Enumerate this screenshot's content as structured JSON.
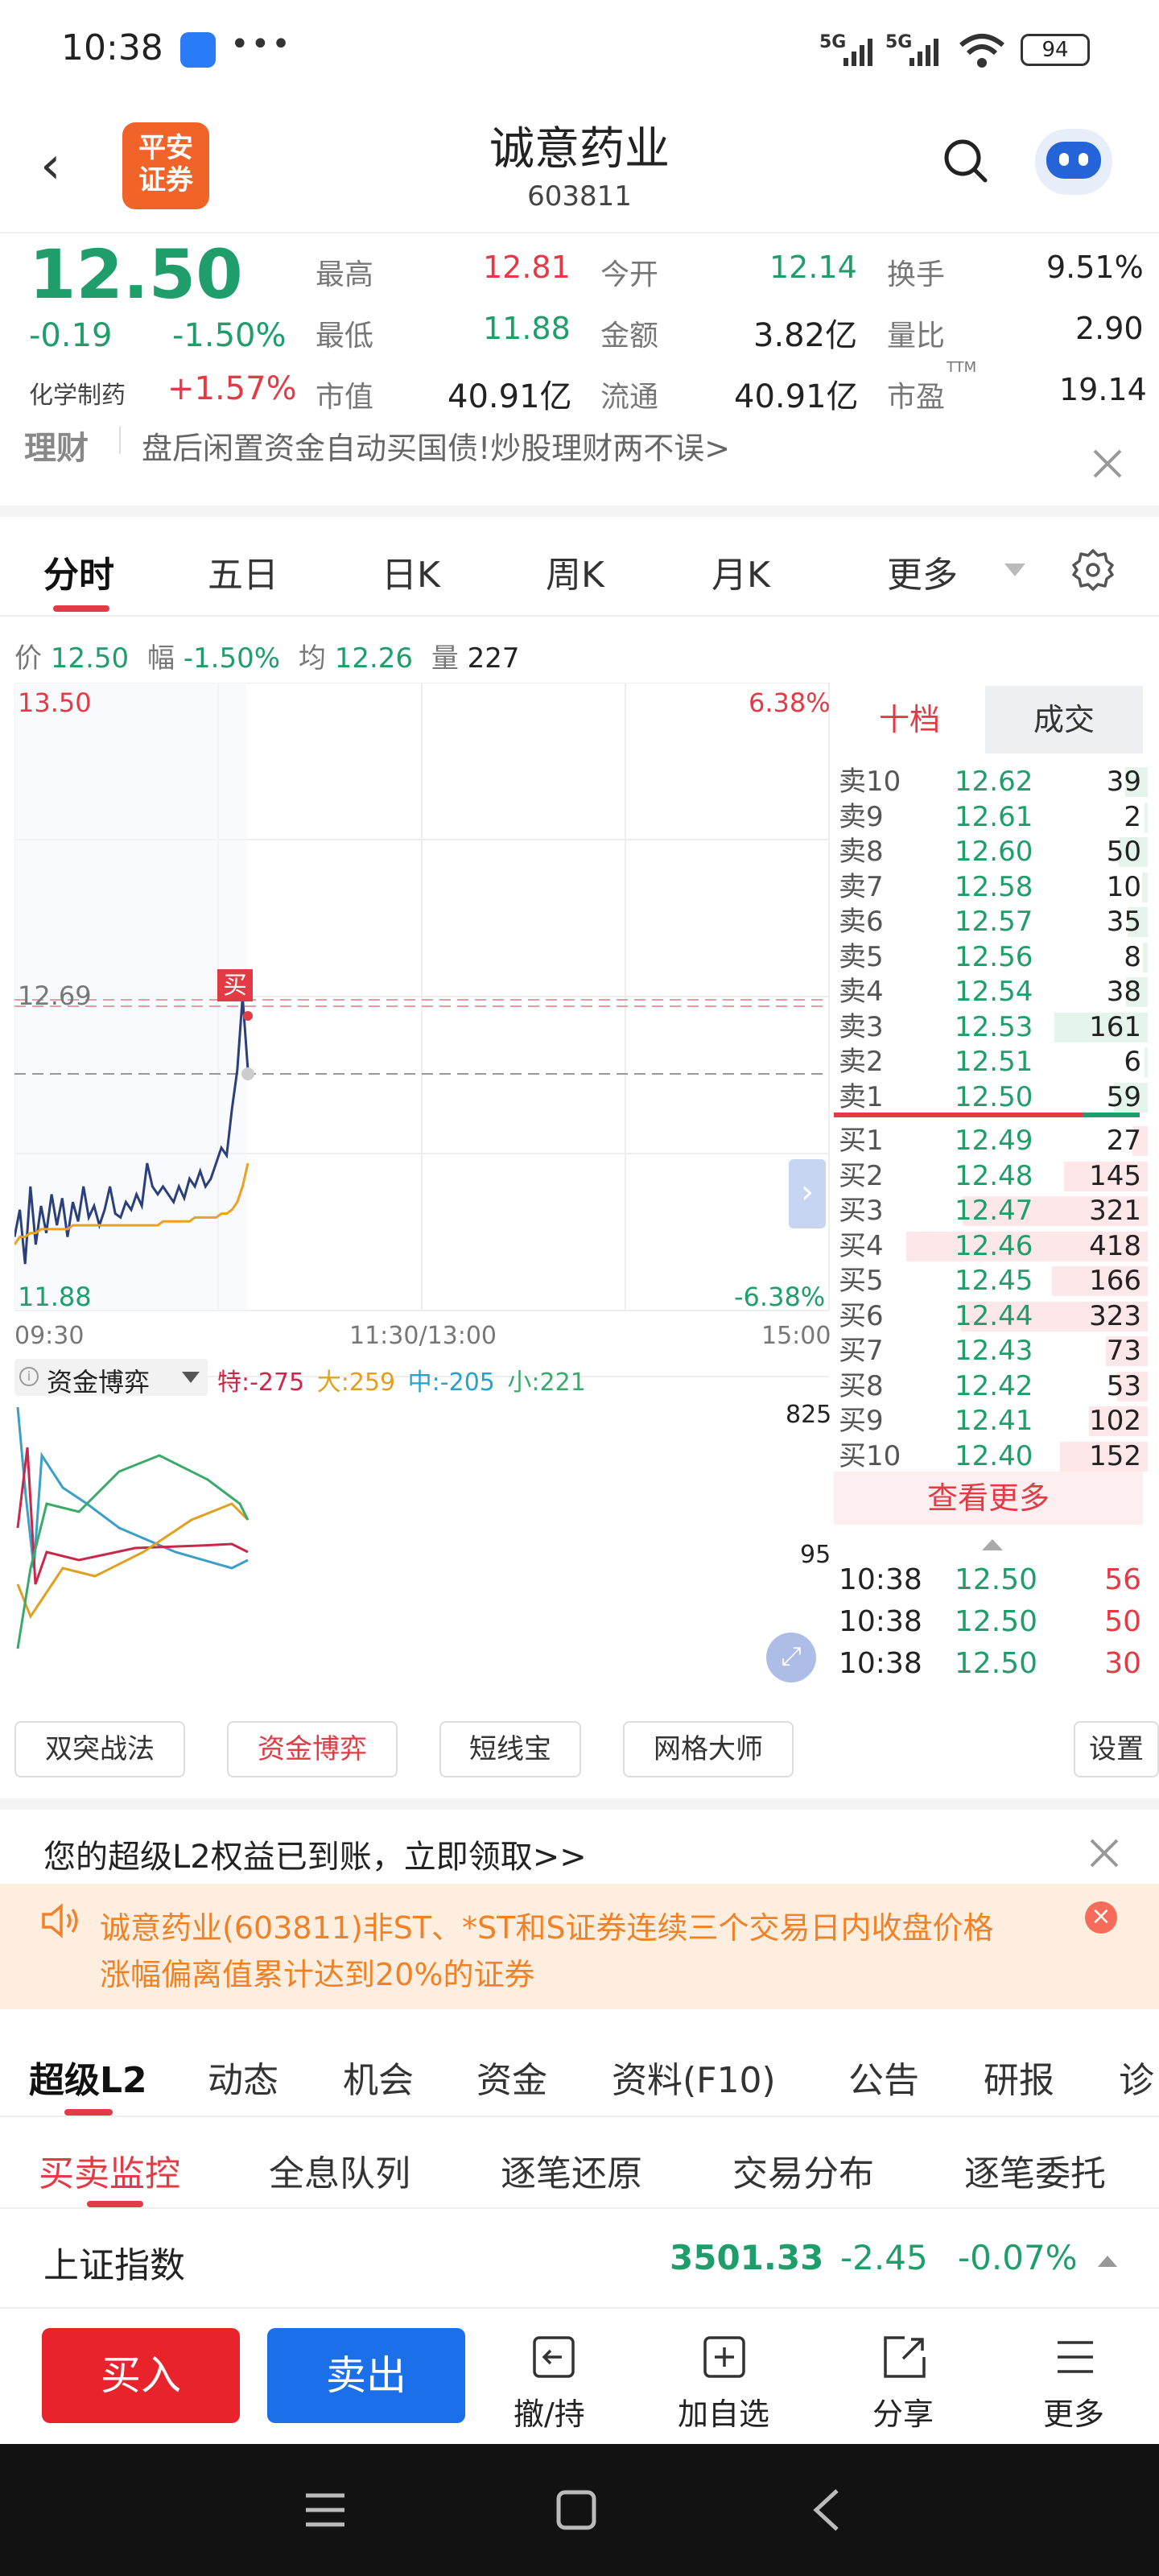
{
  "status_bar": {
    "time": "10:38",
    "dots": "•••",
    "signal1": "5G",
    "signal2": "5G",
    "battery": "94"
  },
  "header": {
    "back_icon": "chevron-left-icon",
    "logo_line1": "平安",
    "logo_line2": "证券",
    "title": "诚意药业",
    "code": "603811"
  },
  "quote": {
    "price": "12.50",
    "change": "-0.19",
    "change_pct": "-1.50%",
    "sector": "化学制药",
    "sector_pct": "+1.57%",
    "high_label": "最高",
    "high": "12.81",
    "low_label": "最低",
    "low": "11.88",
    "mktcap_label": "市值",
    "mktcap": "40.91亿",
    "open_label": "今开",
    "open": "12.14",
    "amount_label": "金额",
    "amount": "3.82亿",
    "float_label": "流通",
    "float": "40.91亿",
    "turnover_label": "换手",
    "turnover": "9.51%",
    "volratio_label": "量比",
    "volratio": "2.90",
    "pe_label": "市盈",
    "pe_sup": "TTM",
    "pe": "19.14"
  },
  "banner": {
    "tag": "理财",
    "text": "盘后闲置资金自动买国债!炒股理财两不误>"
  },
  "chart_tabs": {
    "items": [
      "分时",
      "五日",
      "日K",
      "周K",
      "月K",
      "更多"
    ]
  },
  "info_line": {
    "price_label": "价",
    "price": "12.50",
    "range_label": "幅",
    "range": "-1.50%",
    "avg_label": "均",
    "avg": "12.26",
    "vol_label": "量",
    "vol": "227"
  },
  "chart_labels": {
    "y_top": "13.50",
    "y_mark": "12.69",
    "y_bottom": "11.88",
    "pct_top": "6.38%",
    "pct_bottom": "-6.38%",
    "x_start": "09:30",
    "x_mid": "11:30/13:00",
    "x_end": "15:00",
    "buy_marker": "买",
    "fund_title": "资金博弈",
    "fund_te_label": "特:",
    "fund_te": "-275",
    "fund_da_label": "大:",
    "fund_da": "259",
    "fund_zhong_label": "中:",
    "fund_zhong": "-205",
    "fund_xiao_label": "小:",
    "fund_xiao": "221",
    "fund_y_top": "825",
    "fund_y_mid": "95"
  },
  "chart_data": [
    {
      "type": "line",
      "title": "",
      "ylim": [
        11.88,
        13.5
      ],
      "xlabel": "",
      "ylabel": "",
      "grid": true,
      "x_ticks": [
        "09:30",
        "11:30/13:00",
        "15:00"
      ],
      "series": [
        {
          "values": [
            12.07,
            12.14,
            12.0,
            12.2,
            12.05,
            12.15,
            12.08,
            12.18,
            12.1,
            12.17,
            12.07,
            12.16,
            12.11,
            12.2,
            12.12,
            12.15,
            12.1,
            12.14,
            12.2,
            12.13,
            12.12,
            12.16,
            12.14,
            12.18,
            12.15,
            12.26,
            12.2,
            12.18,
            12.2,
            12.18,
            12.16,
            12.2,
            12.17,
            12.22,
            12.2,
            12.24,
            12.2,
            12.22,
            12.26,
            12.3,
            12.28,
            12.4,
            12.5,
            12.69,
            12.5
          ]
        },
        {
          "values": [
            12.05,
            12.07,
            12.07,
            12.08,
            12.08,
            12.09,
            12.09,
            12.09,
            12.09,
            12.09,
            12.09,
            12.1,
            12.1,
            12.1,
            12.1,
            12.1,
            12.1,
            12.1,
            12.1,
            12.1,
            12.1,
            12.1,
            12.1,
            12.1,
            12.1,
            12.1,
            12.1,
            12.1,
            12.11,
            12.11,
            12.11,
            12.11,
            12.11,
            12.11,
            12.12,
            12.12,
            12.12,
            12.12,
            12.12,
            12.13,
            12.13,
            12.14,
            12.16,
            12.2,
            12.26
          ]
        }
      ]
    }
  ],
  "order_book": {
    "tab_active": "十档",
    "tab_other": "成交",
    "asks": [
      {
        "label": "卖10",
        "price": "12.62",
        "vol": "39"
      },
      {
        "label": "卖9",
        "price": "12.61",
        "vol": "2"
      },
      {
        "label": "卖8",
        "price": "12.60",
        "vol": "50"
      },
      {
        "label": "卖7",
        "price": "12.58",
        "vol": "10"
      },
      {
        "label": "卖6",
        "price": "12.57",
        "vol": "35"
      },
      {
        "label": "卖5",
        "price": "12.56",
        "vol": "8"
      },
      {
        "label": "卖4",
        "price": "12.54",
        "vol": "38"
      },
      {
        "label": "卖3",
        "price": "12.53",
        "vol": "161"
      },
      {
        "label": "卖2",
        "price": "12.51",
        "vol": "6"
      },
      {
        "label": "卖1",
        "price": "12.50",
        "vol": "59"
      }
    ],
    "bids": [
      {
        "label": "买1",
        "price": "12.49",
        "vol": "27"
      },
      {
        "label": "买2",
        "price": "12.48",
        "vol": "145"
      },
      {
        "label": "买3",
        "price": "12.47",
        "vol": "321"
      },
      {
        "label": "买4",
        "price": "12.46",
        "vol": "418"
      },
      {
        "label": "买5",
        "price": "12.45",
        "vol": "166"
      },
      {
        "label": "买6",
        "price": "12.44",
        "vol": "323"
      },
      {
        "label": "买7",
        "price": "12.43",
        "vol": "73"
      },
      {
        "label": "买8",
        "price": "12.42",
        "vol": "53"
      },
      {
        "label": "买9",
        "price": "12.41",
        "vol": "102"
      },
      {
        "label": "买10",
        "price": "12.40",
        "vol": "152"
      }
    ],
    "more": "查看更多",
    "trades": [
      {
        "time": "10:38",
        "price": "12.50",
        "vol": "56"
      },
      {
        "time": "10:38",
        "price": "12.50",
        "vol": "50"
      },
      {
        "time": "10:38",
        "price": "12.50",
        "vol": "30"
      }
    ]
  },
  "strategy_buttons": [
    "双突战法",
    "资金博弈",
    "短线宝",
    "网格大师"
  ],
  "settings_button": "设置",
  "promo": {
    "text": "您的超级L2权益已到账，立即领取>>"
  },
  "notice": {
    "line1": "诚意药业(603811)非ST、*ST和S证券连续三个交易日内收盘价格",
    "line2": "涨幅偏离值累计达到20%的证券"
  },
  "l2_tabs": [
    "超级L2",
    "动态",
    "机会",
    "资金",
    "资料(F10)",
    "公告",
    "研报",
    "诊"
  ],
  "sub_tabs": [
    "买卖监控",
    "全息队列",
    "逐笔还原",
    "交易分布",
    "逐笔委托"
  ],
  "index_bar": {
    "name": "上证指数",
    "value": "3501.33",
    "change": "-2.45",
    "change_pct": "-0.07%"
  },
  "bottom_bar": {
    "buy": "买入",
    "sell": "卖出",
    "cancel": "撤/持",
    "add": "加自选",
    "share": "分享",
    "more": "更多"
  },
  "colors": {
    "up": "#e23b45",
    "down": "#1f9e6b",
    "accent": "#e23b45",
    "sell_btn": "#1b6fe8",
    "buy_btn": "#e8232b"
  }
}
